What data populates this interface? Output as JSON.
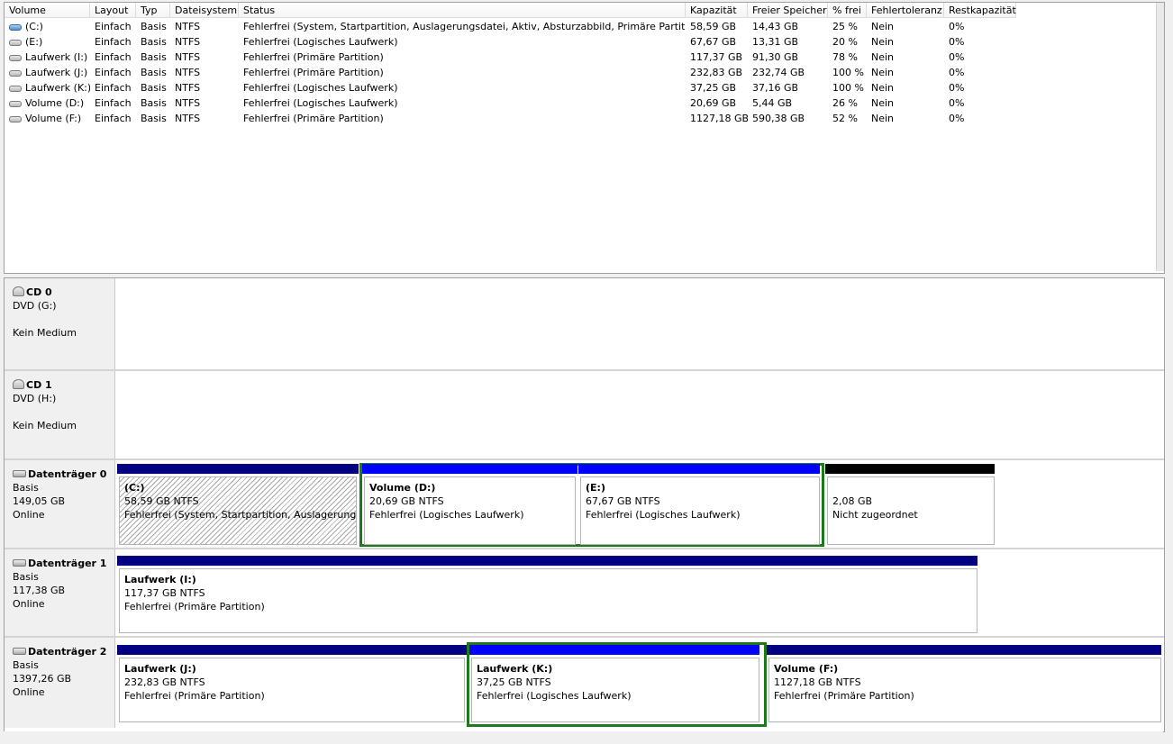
{
  "columns": [
    "Volume",
    "Layout",
    "Typ",
    "Dateisystem",
    "Status",
    "Kapazität",
    "Freier Speicher",
    "% frei",
    "Fehlertoleranz",
    "Restkapazität"
  ],
  "volumes": [
    {
      "icon": "system-drive-icon",
      "volume": "(C:)",
      "layout": "Einfach",
      "typ": "Basis",
      "fs": "NTFS",
      "status": "Fehlerfrei (System, Startpartition, Auslagerungsdatei, Aktiv, Absturzabbild, Primäre Partition)",
      "capacity": "58,59 GB",
      "free": "14,43 GB",
      "pct": "25 %",
      "fault": "Nein",
      "overhead": "0%"
    },
    {
      "icon": "drive-icon",
      "volume": "(E:)",
      "layout": "Einfach",
      "typ": "Basis",
      "fs": "NTFS",
      "status": "Fehlerfrei (Logisches Laufwerk)",
      "capacity": "67,67 GB",
      "free": "13,31 GB",
      "pct": "20 %",
      "fault": "Nein",
      "overhead": "0%"
    },
    {
      "icon": "drive-icon",
      "volume": "Laufwerk (I:)",
      "layout": "Einfach",
      "typ": "Basis",
      "fs": "NTFS",
      "status": "Fehlerfrei (Primäre Partition)",
      "capacity": "117,37 GB",
      "free": "91,30 GB",
      "pct": "78 %",
      "fault": "Nein",
      "overhead": "0%"
    },
    {
      "icon": "drive-icon",
      "volume": "Laufwerk (J:)",
      "layout": "Einfach",
      "typ": "Basis",
      "fs": "NTFS",
      "status": "Fehlerfrei (Primäre Partition)",
      "capacity": "232,83 GB",
      "free": "232,74 GB",
      "pct": "100 %",
      "fault": "Nein",
      "overhead": "0%"
    },
    {
      "icon": "drive-icon",
      "volume": "Laufwerk (K:)",
      "layout": "Einfach",
      "typ": "Basis",
      "fs": "NTFS",
      "status": "Fehlerfrei (Logisches Laufwerk)",
      "capacity": "37,25 GB",
      "free": "37,16 GB",
      "pct": "100 %",
      "fault": "Nein",
      "overhead": "0%"
    },
    {
      "icon": "drive-icon",
      "volume": "Volume (D:)",
      "layout": "Einfach",
      "typ": "Basis",
      "fs": "NTFS",
      "status": "Fehlerfrei (Logisches Laufwerk)",
      "capacity": "20,69 GB",
      "free": "5,44 GB",
      "pct": "26 %",
      "fault": "Nein",
      "overhead": "0%"
    },
    {
      "icon": "drive-icon",
      "volume": "Volume (F:)",
      "layout": "Einfach",
      "typ": "Basis",
      "fs": "NTFS",
      "status": "Fehlerfrei (Primäre Partition)",
      "capacity": "1127,18 GB",
      "free": "590,38 GB",
      "pct": "52 %",
      "fault": "Nein",
      "overhead": "0%"
    }
  ],
  "disks": {
    "cd0": {
      "icon": "cd-drive-icon",
      "name": "CD 0",
      "line1": "DVD (G:)",
      "line2": "",
      "line3": "Kein Medium"
    },
    "cd1": {
      "icon": "cd-drive-icon",
      "name": "CD 1",
      "line1": "DVD (H:)",
      "line2": "",
      "line3": "Kein Medium"
    },
    "disk0": {
      "icon": "hard-disk-icon",
      "name": "Datenträger 0",
      "type": "Basis",
      "size": "149,05 GB",
      "state": "Online",
      "partitions": [
        {
          "title": "(C:)",
          "size": "58,59 GB NTFS",
          "status": "Fehlerfrei (System, Startpartition, Auslagerungsdatei, Aktiv, Absturzabbild, Primäre Partition)"
        },
        {
          "title": "Volume  (D:)",
          "size": "20,69 GB NTFS",
          "status": "Fehlerfrei (Logisches Laufwerk)"
        },
        {
          "title": "(E:)",
          "size": "67,67 GB NTFS",
          "status": "Fehlerfrei (Logisches Laufwerk)"
        },
        {
          "title": "",
          "size": "2,08 GB",
          "status": "Nicht zugeordnet"
        }
      ]
    },
    "disk1": {
      "icon": "hard-disk-icon",
      "name": "Datenträger 1",
      "type": "Basis",
      "size": "117,38 GB",
      "state": "Online",
      "partitions": [
        {
          "title": "Laufwerk  (I:)",
          "size": "117,37 GB NTFS",
          "status": "Fehlerfrei (Primäre Partition)"
        }
      ]
    },
    "disk2": {
      "icon": "hard-disk-icon",
      "name": "Datenträger 2",
      "type": "Basis",
      "size": "1397,26 GB",
      "state": "Online",
      "partitions": [
        {
          "title": "Laufwerk  (J:)",
          "size": "232,83 GB NTFS",
          "status": "Fehlerfrei (Primäre Partition)"
        },
        {
          "title": "Laufwerk  (K:)",
          "size": "37,25 GB NTFS",
          "status": "Fehlerfrei (Logisches Laufwerk)"
        },
        {
          "title": "Volume  (F:)",
          "size": "1127,18 GB NTFS",
          "status": "Fehlerfrei (Primäre Partition)"
        }
      ]
    }
  }
}
